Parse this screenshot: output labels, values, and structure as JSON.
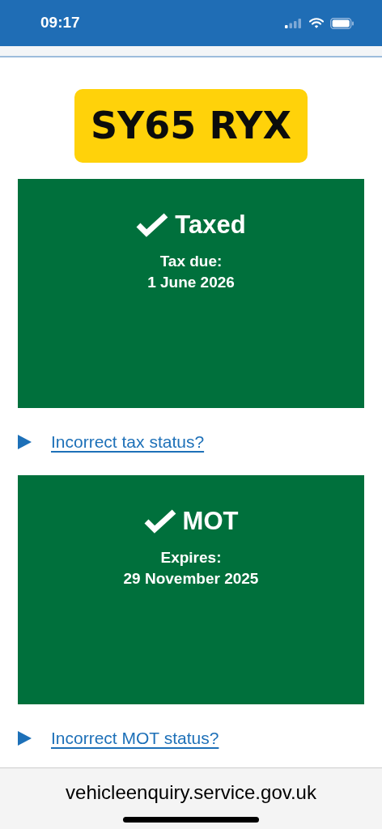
{
  "status_bar": {
    "time": "09:17"
  },
  "plate": "SY65 RYX",
  "panels": [
    {
      "kind": "valid",
      "title": "Taxed",
      "label": "Tax due:",
      "date": "1 June 2026",
      "link": "Incorrect tax status?"
    },
    {
      "kind": "valid",
      "title": "MOT",
      "label": "Expires:",
      "date": "29 November 2025",
      "link": "Incorrect MOT status?"
    }
  ],
  "address_bar": {
    "url": "vehicleenquiry.service.gov.uk"
  }
}
